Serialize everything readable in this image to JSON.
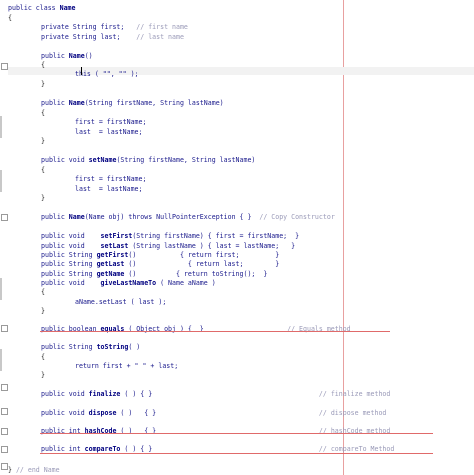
{
  "editor": {
    "lines": [
      {
        "indent": 0,
        "segments": [
          {
            "t": "public class ",
            "c": "kw"
          },
          {
            "t": "Name",
            "c": "bold"
          }
        ]
      },
      {
        "indent": 0,
        "segments": [
          {
            "t": "{",
            "c": "br"
          }
        ]
      },
      {
        "indent": 1,
        "segments": [
          {
            "t": "private String ",
            "c": "kw"
          },
          {
            "t": "first",
            "c": "kw"
          },
          {
            "t": ";   ",
            "c": "kw"
          },
          {
            "t": "// first name",
            "c": "cm"
          }
        ]
      },
      {
        "indent": 1,
        "segments": [
          {
            "t": "private String ",
            "c": "kw"
          },
          {
            "t": "last",
            "c": "kw"
          },
          {
            "t": ";    ",
            "c": "kw"
          },
          {
            "t": "// last name",
            "c": "cm"
          }
        ]
      },
      {
        "indent": 0,
        "segments": []
      },
      {
        "indent": 1,
        "segments": [
          {
            "t": "public ",
            "c": "kw"
          },
          {
            "t": "Name",
            "c": "bold"
          },
          {
            "t": "()",
            "c": "kw"
          }
        ]
      },
      {
        "indent": 1,
        "segments": [
          {
            "t": "{",
            "c": "br"
          }
        ]
      },
      {
        "indent": 2,
        "segments": [
          {
            "t": "this ( \"\", \"\" );",
            "c": "kw"
          }
        ]
      },
      {
        "indent": 1,
        "segments": [
          {
            "t": "}",
            "c": "br"
          }
        ]
      },
      {
        "indent": 0,
        "segments": []
      },
      {
        "indent": 1,
        "segments": [
          {
            "t": "public ",
            "c": "kw"
          },
          {
            "t": "Name",
            "c": "bold"
          },
          {
            "t": "(String firstName, String lastName)",
            "c": "kw"
          }
        ]
      },
      {
        "indent": 1,
        "segments": [
          {
            "t": "{",
            "c": "br"
          }
        ]
      },
      {
        "indent": 2,
        "segments": [
          {
            "t": "first = firstName;",
            "c": "kw"
          }
        ]
      },
      {
        "indent": 2,
        "segments": [
          {
            "t": "last  = lastName;",
            "c": "kw"
          }
        ]
      },
      {
        "indent": 1,
        "segments": [
          {
            "t": "}",
            "c": "br"
          }
        ]
      },
      {
        "indent": 0,
        "segments": []
      },
      {
        "indent": 1,
        "segments": [
          {
            "t": "public void ",
            "c": "kw"
          },
          {
            "t": "setName",
            "c": "bold"
          },
          {
            "t": "(String firstName, String lastName)",
            "c": "kw"
          }
        ]
      },
      {
        "indent": 1,
        "segments": [
          {
            "t": "{",
            "c": "br"
          }
        ]
      },
      {
        "indent": 2,
        "segments": [
          {
            "t": "first = firstName;",
            "c": "kw"
          }
        ]
      },
      {
        "indent": 2,
        "segments": [
          {
            "t": "last  = lastName;",
            "c": "kw"
          }
        ]
      },
      {
        "indent": 1,
        "segments": [
          {
            "t": "}",
            "c": "br"
          }
        ]
      },
      {
        "indent": 0,
        "segments": []
      },
      {
        "indent": 1,
        "segments": [
          {
            "t": "public ",
            "c": "kw"
          },
          {
            "t": "Name",
            "c": "bold"
          },
          {
            "t": "(Name obj) throws NullPointerException { }  ",
            "c": "kw"
          },
          {
            "t": "// Copy Constructor",
            "c": "cm"
          }
        ]
      },
      {
        "indent": 0,
        "segments": []
      },
      {
        "indent": 1,
        "segments": [
          {
            "t": "public void    ",
            "c": "kw"
          },
          {
            "t": "setFirst",
            "c": "bold"
          },
          {
            "t": "(String firstName) { first = firstName;  }",
            "c": "kw"
          }
        ]
      },
      {
        "indent": 1,
        "segments": [
          {
            "t": "public void    ",
            "c": "kw"
          },
          {
            "t": "setLast",
            "c": "bold"
          },
          {
            "t": " (String lastName ) { last = lastName;   }",
            "c": "kw"
          }
        ]
      },
      {
        "indent": 1,
        "segments": [
          {
            "t": "public String ",
            "c": "kw"
          },
          {
            "t": "getFirst",
            "c": "bold"
          },
          {
            "t": "()           { return first;         }",
            "c": "kw"
          }
        ]
      },
      {
        "indent": 1,
        "segments": [
          {
            "t": "public String ",
            "c": "kw"
          },
          {
            "t": "getLast",
            "c": "bold"
          },
          {
            "t": " ()             { return last;        }",
            "c": "kw"
          }
        ]
      },
      {
        "indent": 1,
        "segments": [
          {
            "t": "public String ",
            "c": "kw"
          },
          {
            "t": "getName",
            "c": "bold"
          },
          {
            "t": " ()          { return toString();  }",
            "c": "kw"
          }
        ]
      },
      {
        "indent": 1,
        "segments": [
          {
            "t": "public void    ",
            "c": "kw"
          },
          {
            "t": "giveLastNameTo",
            "c": "bold"
          },
          {
            "t": " ( Name aName )",
            "c": "kw"
          }
        ]
      },
      {
        "indent": 1,
        "segments": [
          {
            "t": "{",
            "c": "br"
          }
        ]
      },
      {
        "indent": 2,
        "segments": [
          {
            "t": "aName.setLast ( last );",
            "c": "kw"
          }
        ]
      },
      {
        "indent": 1,
        "segments": [
          {
            "t": "}",
            "c": "br"
          }
        ]
      },
      {
        "indent": 0,
        "segments": []
      },
      {
        "indent": 1,
        "segments": [
          {
            "t": "public boolean ",
            "c": "kw"
          },
          {
            "t": "equals",
            "c": "bold"
          },
          {
            "t": " ( Object obj ) {  }                     ",
            "c": "kw"
          },
          {
            "t": "// Equals method",
            "c": "cm"
          }
        ]
      },
      {
        "indent": 0,
        "segments": []
      },
      {
        "indent": 1,
        "segments": [
          {
            "t": "public String ",
            "c": "kw"
          },
          {
            "t": "toString",
            "c": "bold"
          },
          {
            "t": "( )",
            "c": "kw"
          }
        ]
      },
      {
        "indent": 1,
        "segments": [
          {
            "t": "{",
            "c": "br"
          }
        ]
      },
      {
        "indent": 2,
        "segments": [
          {
            "t": "return first + \" \" + last;",
            "c": "kw"
          }
        ]
      },
      {
        "indent": 1,
        "segments": [
          {
            "t": "}",
            "c": "br"
          }
        ]
      },
      {
        "indent": 0,
        "segments": []
      },
      {
        "indent": 1,
        "segments": [
          {
            "t": "public void ",
            "c": "kw"
          },
          {
            "t": "finalize",
            "c": "bold"
          },
          {
            "t": " ( ) { }                                          ",
            "c": "kw"
          },
          {
            "t": "// finalize method",
            "c": "cm"
          }
        ]
      },
      {
        "indent": 0,
        "segments": []
      },
      {
        "indent": 1,
        "segments": [
          {
            "t": "public void ",
            "c": "kw"
          },
          {
            "t": "dispose",
            "c": "bold"
          },
          {
            "t": " ( )   { }                                         ",
            "c": "kw"
          },
          {
            "t": "// dispose method",
            "c": "cm"
          }
        ]
      },
      {
        "indent": 0,
        "segments": []
      },
      {
        "indent": 1,
        "segments": [
          {
            "t": "public int ",
            "c": "kw"
          },
          {
            "t": "hashCode",
            "c": "bold"
          },
          {
            "t": " ( )   { }                                         ",
            "c": "kw"
          },
          {
            "t": "// hashCode method",
            "c": "cm"
          }
        ]
      },
      {
        "indent": 0,
        "segments": []
      },
      {
        "indent": 1,
        "segments": [
          {
            "t": "public int ",
            "c": "kw"
          },
          {
            "t": "compareTo",
            "c": "bold"
          },
          {
            "t": " ( ) { }                                          ",
            "c": "kw"
          },
          {
            "t": "// compareTo Method",
            "c": "cm"
          }
        ]
      },
      {
        "indent": 0,
        "segments": []
      },
      {
        "indent": 0,
        "segments": [
          {
            "t": "} ",
            "c": "br"
          },
          {
            "t": "// end Name",
            "c": "cm"
          }
        ]
      }
    ]
  }
}
